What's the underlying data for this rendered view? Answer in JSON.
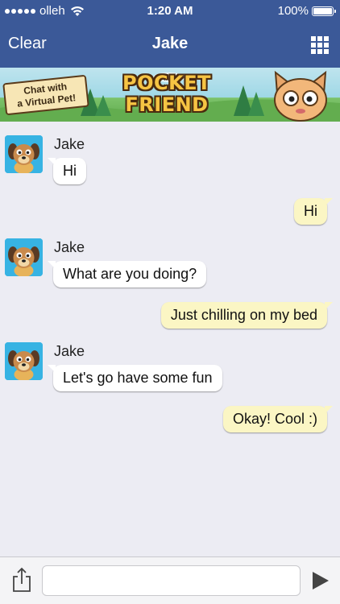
{
  "status_bar": {
    "carrier": "olleh",
    "time": "1:20 AM",
    "battery": "100%",
    "icons": [
      "signal-dots",
      "wifi-icon",
      "battery-icon"
    ]
  },
  "nav": {
    "left_button": "Clear",
    "title": "Jake",
    "right_icon": "grid-icon"
  },
  "banner": {
    "sign_line1": "Chat with",
    "sign_line2": "a Virtual Pet!",
    "title_line1": "POCKET",
    "title_line2": "FRIEND",
    "mascot_icon": "cat-icon"
  },
  "chat": {
    "messages": [
      {
        "direction": "in",
        "sender": "Jake",
        "text": "Hi",
        "avatar_icon": "dog-avatar"
      },
      {
        "direction": "out",
        "text": "Hi"
      },
      {
        "direction": "in",
        "sender": "Jake",
        "text": "What are you doing?",
        "avatar_icon": "dog-avatar"
      },
      {
        "direction": "out",
        "text": "Just chilling on my bed"
      },
      {
        "direction": "in",
        "sender": "Jake",
        "text": "Let's go have some fun",
        "avatar_icon": "dog-avatar"
      },
      {
        "direction": "out",
        "text": "Okay! Cool :)"
      }
    ]
  },
  "input_bar": {
    "share_icon": "share-icon",
    "placeholder": "",
    "value": "",
    "send_icon": "send-icon"
  },
  "colors": {
    "nav_blue": "#3b5998",
    "chat_bg": "#ececf3",
    "incoming_bubble": "#ffffff",
    "outgoing_bubble": "#fbf6c4",
    "avatar_bg": "#37b3e3"
  }
}
